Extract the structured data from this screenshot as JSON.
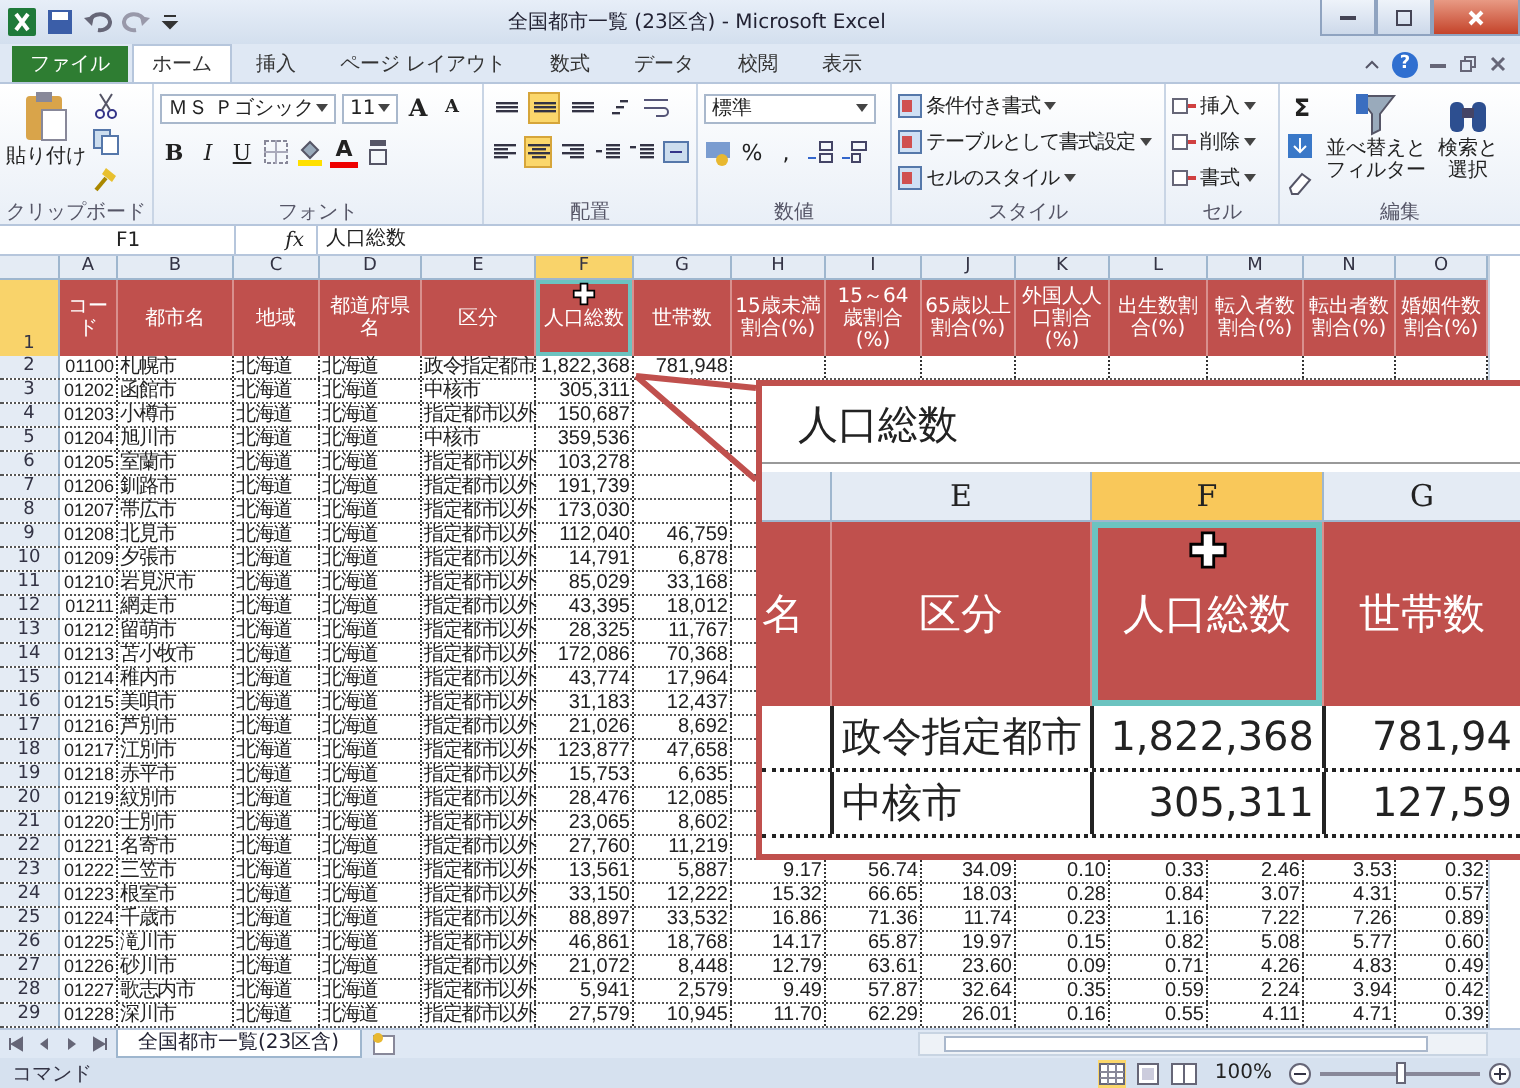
{
  "window": {
    "title": "全国都市一覧 (23区含) - Microsoft Excel"
  },
  "ribbon_tabs": [
    {
      "label": "ファイル",
      "kind": "file",
      "selected": false
    },
    {
      "label": "ホーム",
      "kind": "tab",
      "selected": true
    },
    {
      "label": "挿入",
      "kind": "tab",
      "selected": false
    },
    {
      "label": "ページ レイアウト",
      "kind": "tab",
      "selected": false
    },
    {
      "label": "数式",
      "kind": "tab",
      "selected": false
    },
    {
      "label": "データ",
      "kind": "tab",
      "selected": false
    },
    {
      "label": "校閲",
      "kind": "tab",
      "selected": false
    },
    {
      "label": "表示",
      "kind": "tab",
      "selected": false
    }
  ],
  "help": "?",
  "ribbon": {
    "clipboard": {
      "paste": "貼り付け",
      "label": "クリップボード"
    },
    "font": {
      "name": "ＭＳ Ｐゴシック",
      "size": "11",
      "grow": "A",
      "shrink": "A",
      "styles": [
        "B",
        "I",
        "U"
      ],
      "color_letter": "A",
      "label": "フォント"
    },
    "alignment": {
      "top_row": [
        {
          "kind": "top",
          "selected": false
        },
        {
          "kind": "middle",
          "selected": true
        },
        {
          "kind": "bottom",
          "selected": false
        },
        {
          "kind": "orient",
          "selected": false
        }
      ],
      "bottom_row": [
        {
          "kind": "left",
          "selected": false
        },
        {
          "kind": "center",
          "selected": true
        },
        {
          "kind": "right",
          "selected": false
        },
        {
          "kind": "outdent",
          "selected": false
        },
        {
          "kind": "indent",
          "selected": false
        }
      ],
      "label": "配置"
    },
    "number": {
      "format": "標準",
      "percent": "%",
      "comma": ",",
      "label": "数値"
    },
    "styles": {
      "items": [
        "条件付き書式",
        "テーブルとして書式設定",
        "セルのスタイル"
      ],
      "label": "スタイル"
    },
    "cells": {
      "items": [
        "挿入",
        "削除",
        "書式"
      ],
      "label": "セル"
    },
    "editing": {
      "sum": "Σ",
      "sort": [
        "並べ替えと",
        "フィルター"
      ],
      "find": [
        "検索と",
        "選択"
      ],
      "label": "編集"
    }
  },
  "formula_bar": {
    "name_box": "F1",
    "function_label": "fx",
    "value": "人口総数"
  },
  "columns": [
    {
      "letter": "A",
      "selected": false
    },
    {
      "letter": "B",
      "selected": false
    },
    {
      "letter": "C",
      "selected": false
    },
    {
      "letter": "D",
      "selected": false
    },
    {
      "letter": "E",
      "selected": false
    },
    {
      "letter": "F",
      "selected": true
    },
    {
      "letter": "G",
      "selected": false
    },
    {
      "letter": "H",
      "selected": false
    },
    {
      "letter": "I",
      "selected": false
    },
    {
      "letter": "J",
      "selected": false
    },
    {
      "letter": "K",
      "selected": false
    },
    {
      "letter": "L",
      "selected": false
    },
    {
      "letter": "M",
      "selected": false
    },
    {
      "letter": "N",
      "selected": false
    },
    {
      "letter": "O",
      "selected": false
    }
  ],
  "header_row": {
    "number": "1",
    "selected": true,
    "cells": [
      "コード",
      "都市名",
      "地域",
      "都道府県名",
      "区分",
      "人口総数",
      "世帯数",
      "15歳未満割合(%)",
      "15～64歳割合(%)",
      "65歳以上割合(%)",
      "外国人人口割合(%)",
      "出生数割合(%)",
      "転入者数割合(%)",
      "転出者数割合(%)",
      "婚姻件数割合(%)"
    ]
  },
  "rows": [
    {
      "number": "2",
      "selected": false,
      "code": "01100",
      "city": "札幌市",
      "region": "北海道",
      "prefecture": "北海道",
      "type": "政令指定都市",
      "population": "1,822,368",
      "households": "781,948"
    },
    {
      "number": "3",
      "selected": false,
      "code": "01202",
      "city": "函館市",
      "region": "北海道",
      "prefecture": "北海道",
      "type": "中核市",
      "population": "305,311"
    },
    {
      "number": "4",
      "selected": false,
      "code": "01203",
      "city": "小樽市",
      "region": "北海道",
      "prefecture": "北海道",
      "type": "指定都市以外",
      "population": "150,687"
    },
    {
      "number": "5",
      "selected": false,
      "code": "01204",
      "city": "旭川市",
      "region": "北海道",
      "prefecture": "北海道",
      "type": "中核市",
      "population": "359,536"
    },
    {
      "number": "6",
      "selected": false,
      "code": "01205",
      "city": "室蘭市",
      "region": "北海道",
      "prefecture": "北海道",
      "type": "指定都市以外",
      "population": "103,278"
    },
    {
      "number": "7",
      "selected": false,
      "code": "01206",
      "city": "釧路市",
      "region": "北海道",
      "prefecture": "北海道",
      "type": "指定都市以外",
      "population": "191,739"
    },
    {
      "number": "8",
      "selected": false,
      "code": "01207",
      "city": "帯広市",
      "region": "北海道",
      "prefecture": "北海道",
      "type": "指定都市以外",
      "population": "173,030"
    },
    {
      "number": "9",
      "selected": false,
      "code": "01208",
      "city": "北見市",
      "region": "北海道",
      "prefecture": "北海道",
      "type": "指定都市以外",
      "population": "112,040",
      "households": "46,759"
    },
    {
      "number": "10",
      "selected": false,
      "code": "01209",
      "city": "夕張市",
      "region": "北海道",
      "prefecture": "北海道",
      "type": "指定都市以外",
      "population": "14,791",
      "households": "6,878"
    },
    {
      "number": "11",
      "selected": false,
      "code": "01210",
      "city": "岩見沢市",
      "region": "北海道",
      "prefecture": "北海道",
      "type": "指定都市以外",
      "population": "85,029",
      "households": "33,168"
    },
    {
      "number": "12",
      "selected": false,
      "code": "01211",
      "city": "網走市",
      "region": "北海道",
      "prefecture": "北海道",
      "type": "指定都市以外",
      "population": "43,395",
      "households": "18,012"
    },
    {
      "number": "13",
      "selected": false,
      "code": "01212",
      "city": "留萌市",
      "region": "北海道",
      "prefecture": "北海道",
      "type": "指定都市以外",
      "population": "28,325",
      "households": "11,767"
    },
    {
      "number": "14",
      "selected": false,
      "code": "01213",
      "city": "苫小牧市",
      "region": "北海道",
      "prefecture": "北海道",
      "type": "指定都市以外",
      "population": "172,086",
      "households": "70,368"
    },
    {
      "number": "15",
      "selected": false,
      "code": "01214",
      "city": "稚内市",
      "region": "北海道",
      "prefecture": "北海道",
      "type": "指定都市以外",
      "population": "43,774",
      "households": "17,964"
    },
    {
      "number": "16",
      "selected": false,
      "code": "01215",
      "city": "美唄市",
      "region": "北海道",
      "prefecture": "北海道",
      "type": "指定都市以外",
      "population": "31,183",
      "households": "12,437"
    },
    {
      "number": "17",
      "selected": false,
      "code": "01216",
      "city": "芦別市",
      "region": "北海道",
      "prefecture": "北海道",
      "type": "指定都市以外",
      "population": "21,026",
      "households": "8,692"
    },
    {
      "number": "18",
      "selected": false,
      "code": "01217",
      "city": "江別市",
      "region": "北海道",
      "prefecture": "北海道",
      "type": "指定都市以外",
      "population": "123,877",
      "households": "47,658"
    },
    {
      "number": "19",
      "selected": false,
      "code": "01218",
      "city": "赤平市",
      "region": "北海道",
      "prefecture": "北海道",
      "type": "指定都市以外",
      "population": "15,753",
      "households": "6,635"
    },
    {
      "number": "20",
      "selected": false,
      "code": "01219",
      "city": "紋別市",
      "region": "北海道",
      "prefecture": "北海道",
      "type": "指定都市以外",
      "population": "28,476",
      "households": "12,085"
    },
    {
      "number": "21",
      "selected": false,
      "code": "01220",
      "city": "士別市",
      "region": "北海道",
      "prefecture": "北海道",
      "type": "指定都市以外",
      "population": "23,065",
      "households": "8,602"
    },
    {
      "number": "22",
      "selected": false,
      "code": "01221",
      "city": "名寄市",
      "region": "北海道",
      "prefecture": "北海道",
      "type": "指定都市以外",
      "population": "27,760",
      "households": "11,219"
    },
    {
      "number": "23",
      "selected": false,
      "code": "01222",
      "city": "三笠市",
      "region": "北海道",
      "prefecture": "北海道",
      "type": "指定都市以外",
      "population": "13,561",
      "households": "5,887",
      "ratios": [
        "9.17",
        "56.74",
        "34.09",
        "0.10",
        "0.33",
        "2.46",
        "3.53",
        "0.32"
      ]
    },
    {
      "number": "24",
      "selected": false,
      "code": "01223",
      "city": "根室市",
      "region": "北海道",
      "prefecture": "北海道",
      "type": "指定都市以外",
      "population": "33,150",
      "households": "12,222",
      "ratios": [
        "15.32",
        "66.65",
        "18.03",
        "0.28",
        "0.84",
        "3.07",
        "4.31",
        "0.57"
      ]
    },
    {
      "number": "25",
      "selected": false,
      "code": "01224",
      "city": "千歳市",
      "region": "北海道",
      "prefecture": "北海道",
      "type": "指定都市以外",
      "population": "88,897",
      "households": "33,532",
      "ratios": [
        "16.86",
        "71.36",
        "11.74",
        "0.23",
        "1.16",
        "7.22",
        "7.26",
        "0.89"
      ]
    },
    {
      "number": "26",
      "selected": false,
      "code": "01225",
      "city": "滝川市",
      "region": "北海道",
      "prefecture": "北海道",
      "type": "指定都市以外",
      "population": "46,861",
      "households": "18,768",
      "ratios": [
        "14.17",
        "65.87",
        "19.97",
        "0.15",
        "0.82",
        "5.08",
        "5.77",
        "0.60"
      ]
    },
    {
      "number": "27",
      "selected": false,
      "code": "01226",
      "city": "砂川市",
      "region": "北海道",
      "prefecture": "北海道",
      "type": "指定都市以外",
      "population": "21,072",
      "households": "8,448",
      "ratios": [
        "12.79",
        "63.61",
        "23.60",
        "0.09",
        "0.71",
        "4.26",
        "4.83",
        "0.49"
      ]
    },
    {
      "number": "28",
      "selected": false,
      "code": "01227",
      "city": "歌志内市",
      "region": "北海道",
      "prefecture": "北海道",
      "type": "指定都市以外",
      "population": "5,941",
      "households": "2,579",
      "ratios": [
        "9.49",
        "57.87",
        "32.64",
        "0.35",
        "0.59",
        "2.24",
        "3.94",
        "0.42"
      ]
    },
    {
      "number": "29",
      "selected": false,
      "code": "01228",
      "city": "深川市",
      "region": "北海道",
      "prefecture": "北海道",
      "type": "指定都市以外",
      "population": "27,579",
      "households": "10,945",
      "ratios": [
        "11.70",
        "62.29",
        "26.01",
        "0.16",
        "0.55",
        "4.11",
        "4.71",
        "0.39"
      ]
    }
  ],
  "magnifier": {
    "formula_text": "人口総数",
    "columns": [
      {
        "letter": "E",
        "selected": false
      },
      {
        "letter": "F",
        "selected": true
      },
      {
        "letter": "G",
        "selected": false
      }
    ],
    "headers": [
      "名",
      "区分",
      "人口総数",
      "世帯数"
    ],
    "rows": [
      [
        "政令指定都市",
        "1,822,368",
        "781,94"
      ],
      [
        "中核市",
        "305,311",
        "127,59"
      ]
    ]
  },
  "sheet_tabs": [
    {
      "label": "全国都市一覧(23区含)",
      "selected": true
    }
  ],
  "status_bar": {
    "mode": "コマンド",
    "zoom": "100%",
    "level": 0.5
  }
}
